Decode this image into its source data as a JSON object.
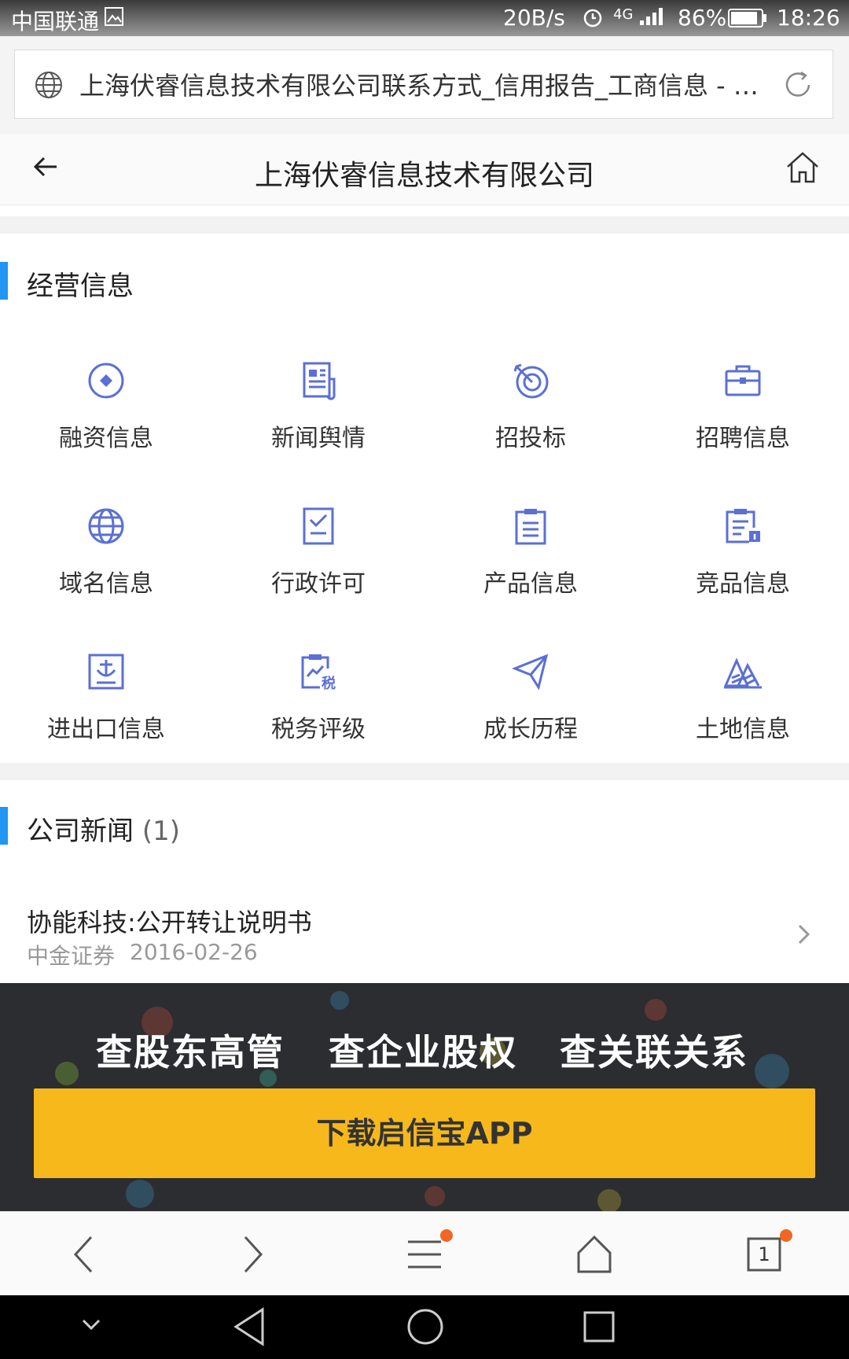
{
  "status_bar": {
    "carrier": "中国联通",
    "speed": "20B/s",
    "network": "4G",
    "battery": "86%",
    "time": "18:26"
  },
  "url_bar": {
    "title": "上海伏睿信息技术有限公司联系方式_信用报告_工商信息 - 启..."
  },
  "header": {
    "title": "上海伏睿信息技术有限公司"
  },
  "business_section": {
    "title": "经营信息",
    "items": [
      {
        "label": "融资信息",
        "icon": "financing-icon"
      },
      {
        "label": "新闻舆情",
        "icon": "news-icon"
      },
      {
        "label": "招投标",
        "icon": "bidding-icon"
      },
      {
        "label": "招聘信息",
        "icon": "briefcase-icon"
      },
      {
        "label": "域名信息",
        "icon": "globe-icon"
      },
      {
        "label": "行政许可",
        "icon": "license-icon"
      },
      {
        "label": "产品信息",
        "icon": "product-icon"
      },
      {
        "label": "竞品信息",
        "icon": "competitor-icon"
      },
      {
        "label": "进出口信息",
        "icon": "import-export-icon"
      },
      {
        "label": "税务评级",
        "icon": "tax-icon"
      },
      {
        "label": "成长历程",
        "icon": "paper-plane-icon"
      },
      {
        "label": "土地信息",
        "icon": "land-icon"
      }
    ]
  },
  "news_section": {
    "title": "公司新闻",
    "count": "(1)",
    "items": [
      {
        "title": "协能科技:公开转让说明书",
        "source": "中金证券",
        "date": "2016-02-26"
      }
    ]
  },
  "banner": {
    "phrases": [
      "查股东高管",
      "查企业股权",
      "查关联关系"
    ],
    "button": "下载启信宝APP"
  },
  "browser_bar": {
    "tab_count": "1"
  },
  "colors": {
    "accent": "#2196f3",
    "icon": "#5b6fd6",
    "button": "#f6b81b",
    "badge": "#f26522"
  }
}
